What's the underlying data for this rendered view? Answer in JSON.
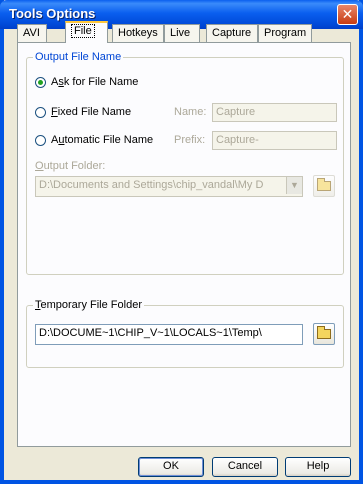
{
  "window": {
    "title": "Tools Options",
    "close_label": "✕"
  },
  "tabs": [
    {
      "label": "AVI"
    },
    {
      "label": "File"
    },
    {
      "label": "Hotkeys"
    },
    {
      "label": "Live"
    },
    {
      "label": "Capture"
    },
    {
      "label": "Program"
    }
  ],
  "output_group": {
    "legend": "Output File Name",
    "ask_label_pre": "A",
    "ask_label_u": "s",
    "ask_label_post": "k for File Name",
    "fixed_label_u": "F",
    "fixed_label_post": "ixed File Name",
    "name_label": "Name:",
    "name_value": "Capture",
    "auto_label_pre": "A",
    "auto_label_u": "u",
    "auto_label_post": "tomatic File Name",
    "prefix_label": "Prefix:",
    "prefix_value": "Capture-",
    "folder_label_u": "O",
    "folder_label_post": "utput Folder:",
    "folder_value": "D:\\Documents and Settings\\chip_vandal\\My D"
  },
  "temp_group": {
    "legend_u": "T",
    "legend_post": "emporary File Folder",
    "folder_value": "D:\\DOCUME~1\\CHIP_V~1\\LOCALS~1\\Temp\\"
  },
  "buttons": {
    "ok": "OK",
    "cancel": "Cancel",
    "help": "Help"
  }
}
